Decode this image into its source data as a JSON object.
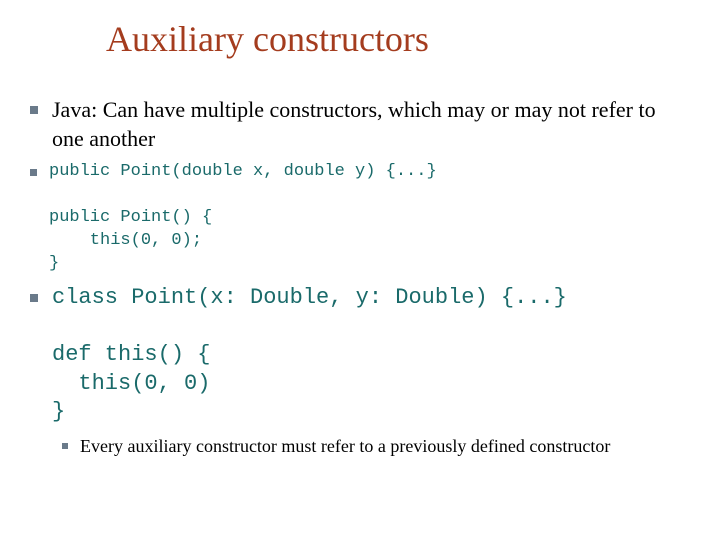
{
  "title": "Auxiliary constructors",
  "items": {
    "java_desc": "Java: Can have multiple constructors, which may or may not refer to one another",
    "java_code": "public Point(double x, double y) {...}\n\npublic Point() {\n    this(0, 0);\n}",
    "scala_code": "class Point(x: Double, y: Double) {...}\n\ndef this() {\n  this(0, 0)\n}",
    "sub_note": "Every auxiliary constructor must refer to a previously defined constructor"
  }
}
